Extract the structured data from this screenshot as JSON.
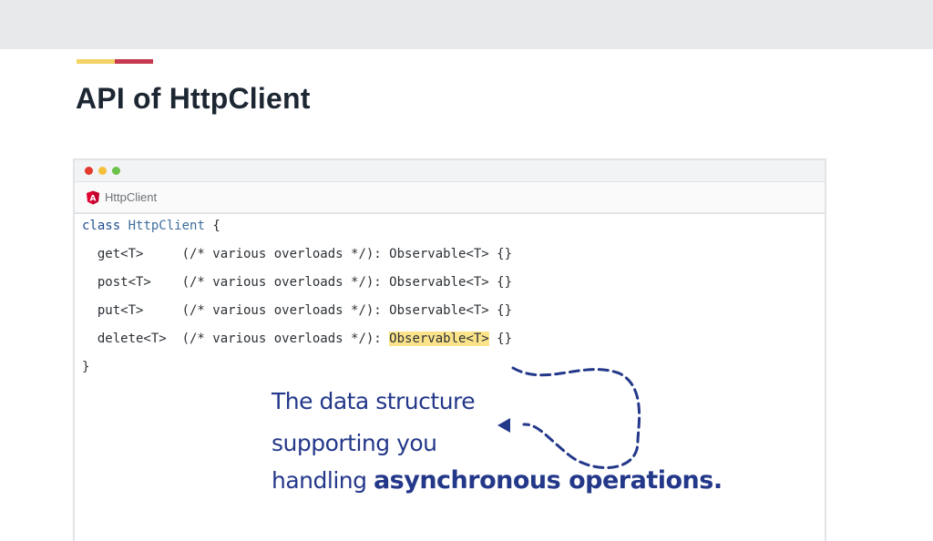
{
  "slide": {
    "title": "API of HttpClient"
  },
  "colors": {
    "accent_yellow": "#f3d266",
    "accent_red": "#c73a4d",
    "annotation": "#24388a",
    "highlight": "#fbe38a",
    "dot_red": "#e23b2e",
    "dot_yellow": "#f4bf3a",
    "dot_green": "#6cc24a"
  },
  "editor": {
    "file_icon": "angular-icon",
    "file_icon_letter": "A",
    "file_name": "HttpClient",
    "code": {
      "line1_kw": "class",
      "line1_cls": "HttpClient",
      "line1_brace": " {",
      "methods": [
        {
          "name": "  get<T>     ",
          "rest": "(/* various overloads */): Observable<T> {}"
        },
        {
          "name": "  post<T>    ",
          "rest": "(/* various overloads */): Observable<T> {}"
        },
        {
          "name": "  put<T>     ",
          "rest": "(/* various overloads */): Observable<T> {}"
        },
        {
          "name": "  delete<T>  ",
          "rest_before": "(/* various overloads */): ",
          "rest_highlight": "Observable<T>",
          "rest_after": " {}"
        }
      ],
      "closing": "}"
    }
  },
  "annotation": {
    "line1": "The data structure",
    "line2": "supporting you",
    "line3_plain": "handling ",
    "line3_strong": "asynchronous operations."
  }
}
